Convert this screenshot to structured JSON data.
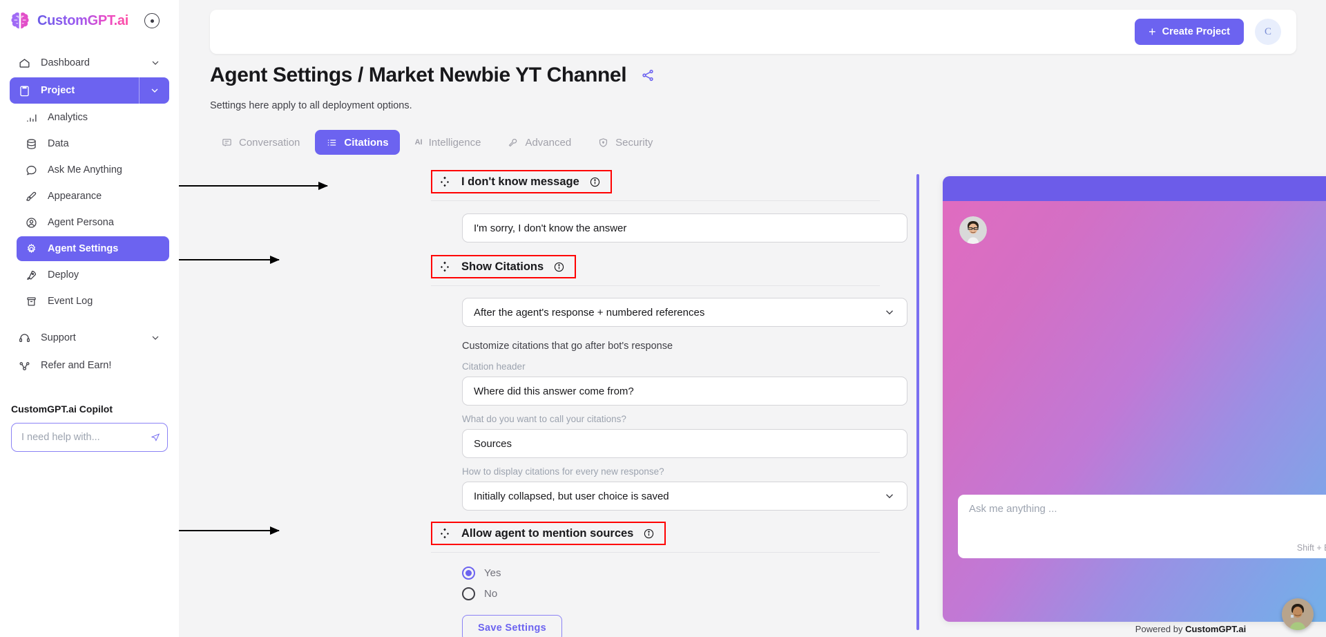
{
  "brand": {
    "name": "CustomGPT.ai",
    "collapse_icon": "collapse-circle-icon"
  },
  "sidebar": {
    "top_items": [
      {
        "label": "Dashboard",
        "icon": "home-icon",
        "caret": "chevron-down-icon",
        "active": false
      },
      {
        "label": "Project",
        "icon": "clipboard-icon",
        "caret": "chevron-down-icon",
        "active": true
      }
    ],
    "project_items": [
      {
        "label": "Analytics",
        "icon": "bar-chart-icon",
        "selected": false
      },
      {
        "label": "Data",
        "icon": "database-icon",
        "selected": false
      },
      {
        "label": "Ask Me Anything",
        "icon": "chat-bubble-icon",
        "selected": false
      },
      {
        "label": "Appearance",
        "icon": "paintbrush-icon",
        "selected": false
      },
      {
        "label": "Agent Persona",
        "icon": "user-circle-icon",
        "selected": false
      },
      {
        "label": "Agent Settings",
        "icon": "gear-icon",
        "selected": true
      },
      {
        "label": "Deploy",
        "icon": "rocket-icon",
        "selected": false
      },
      {
        "label": "Event Log",
        "icon": "archive-icon",
        "selected": false
      }
    ],
    "bottom_items": [
      {
        "label": "Support",
        "icon": "headset-icon",
        "caret": "chevron-down-icon"
      },
      {
        "label": "Refer and Earn!",
        "icon": "share-nodes-icon",
        "caret": ""
      }
    ],
    "copilot": {
      "title": "CustomGPT.ai Copilot",
      "placeholder": "I need help with...",
      "value": "",
      "send_icon": "send-plane-icon"
    }
  },
  "topbar": {
    "create_label": "Create Project",
    "plus_icon": "plus-icon",
    "avatar_initial": "C"
  },
  "page": {
    "title": "Agent Settings / Market Newbie YT Channel",
    "share_icon": "share-nodes-icon",
    "subtitle": "Settings here apply to all deployment options."
  },
  "tabs": [
    {
      "label": "Conversation",
      "icon": "message-square-icon",
      "active": false
    },
    {
      "label": "Citations",
      "icon": "list-citation-icon",
      "active": true
    },
    {
      "label": "Intelligence",
      "icon": "ai-icon",
      "active": false
    },
    {
      "label": "Advanced",
      "icon": "wrench-icon",
      "active": false
    },
    {
      "label": "Security",
      "icon": "shield-icon",
      "active": false
    }
  ],
  "form": {
    "sections": [
      {
        "heading": "I don't know message",
        "handle_icon": "drag-handle-diamonds-icon",
        "info_icon": "info-circle-icon",
        "highlighted": true
      },
      {
        "heading": "Show Citations",
        "handle_icon": "drag-handle-diamonds-icon",
        "info_icon": "info-circle-icon",
        "highlighted": true
      },
      {
        "heading": "Allow agent to mention sources",
        "handle_icon": "drag-handle-diamonds-icon",
        "info_icon": "info-circle-icon",
        "highlighted": true
      }
    ],
    "idk_message_value": "I'm sorry, I don't know the answer",
    "show_citations_value": "After the agent's response + numbered references",
    "customize_text": "Customize citations that go after bot's response",
    "citation_header_label": "Citation header",
    "citation_header_value": "Where did this answer come from?",
    "citation_name_label": "What do you want to call your citations?",
    "citation_name_value": "Sources",
    "citation_display_label": "How to display citations for every new response?",
    "citation_display_value": "Initially collapsed, but user choice is saved",
    "mention_sources_options": [
      {
        "label": "Yes",
        "selected": true
      },
      {
        "label": "No",
        "selected": false
      }
    ],
    "save_label": "Save Settings",
    "chevron_icon": "chevron-down-icon"
  },
  "chat_preview": {
    "refresh_icon": "refresh-icon",
    "close_icon": "close-x-icon",
    "avatar_icon": "person-avatar-icon",
    "input_placeholder": "Ask me anything ...",
    "send_icon": "send-plane-icon",
    "hint": "Shift + Enter to add a new line",
    "powered_prefix": "Powered by ",
    "powered_brand": "CustomGPT.ai"
  },
  "fab": {
    "icon": "person-avatar-icon"
  },
  "colors": {
    "accent": "#6c63f0",
    "annotation": "#ff0000",
    "page_bg": "#f4f4f5",
    "chat_header": "#6c5ce9"
  }
}
